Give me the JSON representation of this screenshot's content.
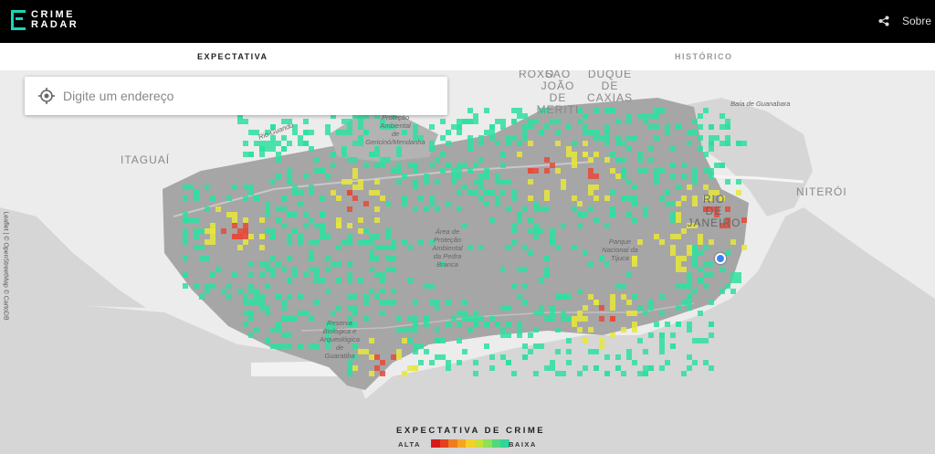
{
  "header": {
    "logo_line1": "CRIME",
    "logo_line2": "RADAR",
    "about_label": "Sobre",
    "share_icon": "share-icon"
  },
  "tabs": [
    {
      "label": "EXPECTATIVA",
      "active": true
    },
    {
      "label": "HISTÓRICO",
      "active": false
    }
  ],
  "search": {
    "placeholder": "Digite um endereço",
    "icon": "locate-icon"
  },
  "map": {
    "labels": {
      "itaguai": "ITAGUAÍ",
      "sao_joao": "SÃO\nJOÃO\nDE\nMERITI",
      "duque": "DUQUE\nDE\nCAXIAS",
      "roxo": "ROXO",
      "niteroi": "NITERÓI",
      "rio": "RIO\nDE\nJANEIRO",
      "rio_guandu": "Rio Guandu",
      "gericino": "Proteção\nAmbiental\nde\nGericinó/Mendanha",
      "pedra_branca": "Área de\nProteção\nAmbiental\nda Pedra\nBranca",
      "tijuca": "Parque\nNacional da\nTijuca",
      "guaratiba": "Reserva\nBiológica e\nArqueológica\nde\nGuaratiba",
      "guanabara": "Baía de Guanabara"
    },
    "attribution": "Leaflet | © OpenStreetMap © CartoDB",
    "colors": {
      "water": "#d6d6d6",
      "land": "#ececec",
      "city": "#a6a6a6",
      "heat_low": "#2ee0a0",
      "heat_mid": "#e8e83a",
      "heat_high": "#e84a3a"
    }
  },
  "legend": {
    "title": "EXPECTATIVA DE CRIME",
    "high_label": "ALTA",
    "low_label": "BAIXA",
    "colors": [
      "#d7191c",
      "#e4411f",
      "#f07c22",
      "#f5a523",
      "#f5d028",
      "#c6e03a",
      "#8ee058",
      "#52d87a",
      "#2fd69a"
    ]
  }
}
